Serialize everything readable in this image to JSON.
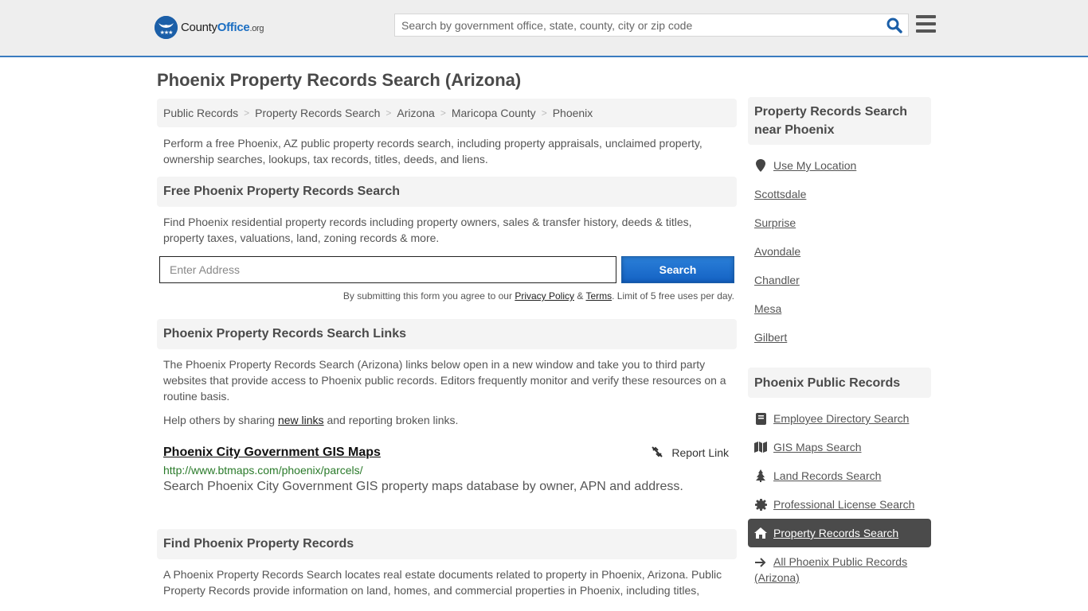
{
  "header": {
    "logo": {
      "county": "County",
      "office": "Office",
      "org": ".org",
      "badge": "★★★"
    },
    "search_placeholder": "Search by government office, state, county, city or zip code"
  },
  "page_title": "Phoenix Property Records Search (Arizona)",
  "breadcrumb": [
    {
      "label": "Public Records"
    },
    {
      "label": "Property Records Search"
    },
    {
      "label": "Arizona"
    },
    {
      "label": "Maricopa County"
    },
    {
      "label": "Phoenix"
    }
  ],
  "intro": "Perform a free Phoenix, AZ public property records search, including property appraisals, unclaimed property, ownership searches, lookups, tax records, titles, deeds, and liens.",
  "free_search": {
    "heading": "Free Phoenix Property Records Search",
    "text": "Find Phoenix residential property records including property owners, sales & transfer history, deeds & titles, property taxes, valuations, land, zoning records & more.",
    "input_placeholder": "Enter Address",
    "button_label": "Search",
    "terms_prefix": "By submitting this form you agree to our ",
    "privacy_label": "Privacy Policy",
    "amp": " & ",
    "terms_label": "Terms",
    "terms_suffix": ". Limit of 5 free uses per day."
  },
  "links_section": {
    "heading": "Phoenix Property Records Search Links",
    "text": "The Phoenix Property Records Search (Arizona) links below open in a new window and take you to third party websites that provide access to Phoenix public records. Editors frequently monitor and verify these resources on a routine basis.",
    "help_prefix": "Help others by sharing ",
    "help_link": "new links",
    "help_suffix": " and reporting broken links.",
    "items": [
      {
        "title": "Phoenix City Government GIS Maps",
        "url": "http://www.btmaps.com/phoenix/parcels/",
        "description": "Search Phoenix City Government GIS property maps database by owner, APN and address.",
        "report_label": "Report Link"
      }
    ]
  },
  "find_section": {
    "heading": "Find Phoenix Property Records",
    "text": "A Phoenix Property Records Search locates real estate documents related to property in Phoenix, Arizona. Public Property Records provide information on land, homes, and commercial properties in Phoenix, including titles,"
  },
  "sidebar": {
    "nearby_heading": "Property Records Search near Phoenix",
    "use_location": "Use My Location",
    "nearby": [
      {
        "label": "Scottsdale"
      },
      {
        "label": "Surprise"
      },
      {
        "label": "Avondale"
      },
      {
        "label": "Chandler"
      },
      {
        "label": "Mesa"
      },
      {
        "label": "Gilbert"
      }
    ],
    "public_heading": "Phoenix Public Records",
    "public_links": [
      {
        "label": "Employee Directory Search",
        "icon": "book-icon"
      },
      {
        "label": "GIS Maps Search",
        "icon": "map-icon"
      },
      {
        "label": "Land Records Search",
        "icon": "tree-icon"
      },
      {
        "label": "Professional License Search",
        "icon": "certificate-icon"
      },
      {
        "label": "Property Records Search",
        "icon": "home-icon",
        "active": true
      },
      {
        "label": "All Phoenix Public Records (Arizona)",
        "icon": "arrow-right-icon"
      }
    ]
  },
  "colors": {
    "brand_blue": "#1b6ec2",
    "header_border": "#3a7bbf",
    "url_green": "#2a7a2a",
    "active_bg": "#4b4b4b"
  }
}
